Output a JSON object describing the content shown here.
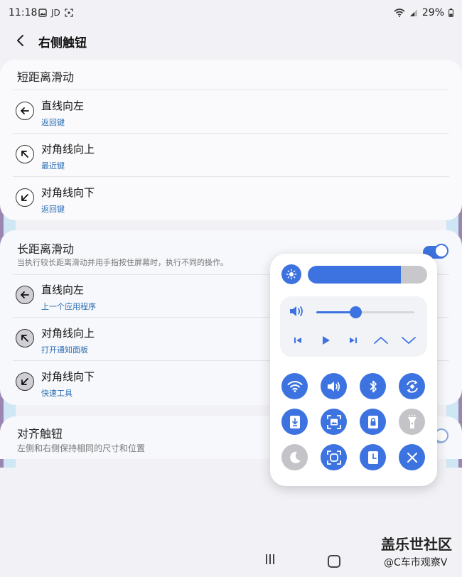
{
  "status": {
    "time": "11:18",
    "carrier": "JD",
    "battery": "29%"
  },
  "header": {
    "title": "右侧触钮"
  },
  "short_swipe": {
    "title": "短距离滑动",
    "items": [
      {
        "label": "直线向左",
        "action": "返回键",
        "icon": "arrow-left-icon"
      },
      {
        "label": "对角线向上",
        "action": "最近键",
        "icon": "arrow-up-left-icon"
      },
      {
        "label": "对角线向下",
        "action": "返回键",
        "icon": "arrow-down-left-icon"
      }
    ]
  },
  "long_swipe": {
    "title": "长距离滑动",
    "description": "当执行较长距离滑动并用手指按住屏幕时，执行不同的操作。",
    "enabled": true,
    "items": [
      {
        "label": "直线向左",
        "action": "上一个应用程序",
        "icon": "arrow-left-icon"
      },
      {
        "label": "对角线向上",
        "action": "打开通知面板",
        "icon": "arrow-up-left-icon"
      },
      {
        "label": "对角线向下",
        "action": "快速工具",
        "icon": "arrow-down-left-icon"
      }
    ]
  },
  "align": {
    "title": "对齐触钮",
    "description": "左侧和右侧保持相同的尺寸和位置",
    "enabled": true
  },
  "quick_panel": {
    "brightness": 0.78,
    "volume": 0.4,
    "media_controls": [
      "prev-track-icon",
      "play-icon",
      "next-track-icon",
      "chevron-up-icon",
      "chevron-down-icon"
    ],
    "tiles": [
      {
        "name": "wifi-icon",
        "on": true
      },
      {
        "name": "sound-icon",
        "on": true
      },
      {
        "name": "bluetooth-icon",
        "on": true
      },
      {
        "name": "auto-rotate-icon",
        "on": true
      },
      {
        "name": "download-icon",
        "on": true
      },
      {
        "name": "screenshot-icon",
        "on": true
      },
      {
        "name": "lock-icon",
        "on": true
      },
      {
        "name": "flashlight-icon",
        "on": false
      },
      {
        "name": "night-mode-icon",
        "on": false
      },
      {
        "name": "screen-capture-icon",
        "on": true
      },
      {
        "name": "clock-icon",
        "on": true
      },
      {
        "name": "close-icon",
        "on": true
      }
    ]
  },
  "watermark": {
    "main": "盖乐世社区",
    "sub": "@C车市观察V"
  },
  "colors": {
    "accent": "#3d73e0",
    "link": "#2a6db5",
    "background": "#f2f2f6"
  }
}
